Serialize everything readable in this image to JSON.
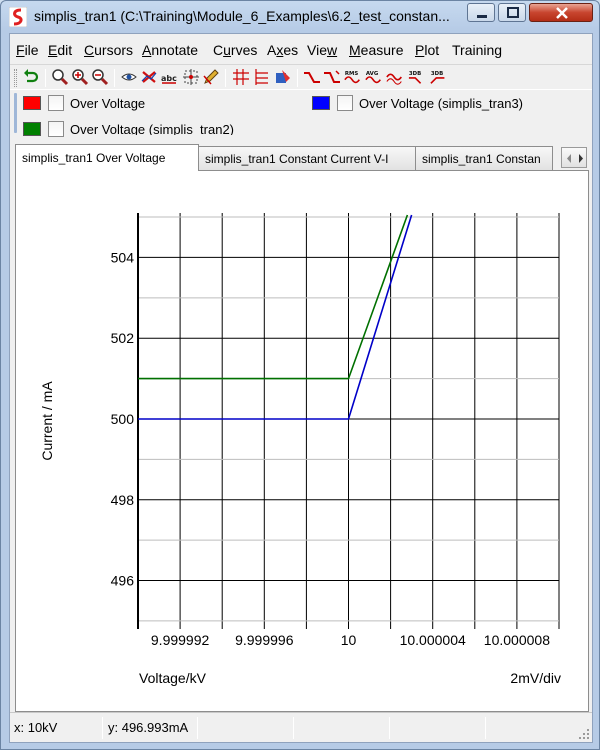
{
  "window": {
    "title": "simplis_tran1 (C:\\Training\\Module_6_Examples\\6.2_test_constan..."
  },
  "menu": [
    {
      "label": "File",
      "accel": "F",
      "rest": "ile"
    },
    {
      "label": "Edit",
      "accel": "E",
      "rest": "dit"
    },
    {
      "label": "Cursors",
      "accel": "C",
      "rest": "ursors"
    },
    {
      "label": "Annotate",
      "accel": "A",
      "rest": "nnotate"
    },
    {
      "label": "Curves",
      "accel": "u",
      "pre": "C",
      "rest": "rves"
    },
    {
      "label": "Axes",
      "accel": "x",
      "pre": "A",
      "rest": "es"
    },
    {
      "label": "View",
      "accel": "w",
      "pre": "Vie",
      "rest": ""
    },
    {
      "label": "Measure",
      "accel": "M",
      "rest": "easure"
    },
    {
      "label": "Plot",
      "accel": "P",
      "rest": "lot"
    },
    {
      "label": "Training",
      "accel": "",
      "rest": "Training"
    }
  ],
  "toolbar": {
    "icons": [
      "undo-icon",
      "zoom-icon",
      "zoom-in-icon",
      "zoom-out-icon",
      "eye-icon",
      "delete-curve-icon",
      "abc-label-icon",
      "cursor-icon",
      "pen-icon",
      "grid-icon",
      "stack-icon",
      "color-icon",
      "rise-icon",
      "fall-icon",
      "rms-icon",
      "avg-icon",
      "wave-icon",
      "3db-high-icon",
      "3db-low-icon"
    ],
    "rms_label": "RMS",
    "avg_label": "AVG",
    "db_label": "3DB"
  },
  "legend": [
    {
      "label": "Over Voltage",
      "color": "#ff0000"
    },
    {
      "label": "Over Voltage (simplis_tran3)",
      "color": "#0000ff"
    },
    {
      "label": "Over Voltage (simplis_tran2)",
      "color": "#008000"
    }
  ],
  "tabs": [
    {
      "label": "simplis_tran1 Over Voltage",
      "active": true
    },
    {
      "label": "simplis_tran1 Constant Current V-I",
      "active": false
    },
    {
      "label": "simplis_tran1 Constan",
      "active": false
    }
  ],
  "status": {
    "x": "x: 10kV",
    "y": "y: 496.993mA"
  },
  "chart_data": {
    "type": "line",
    "xlabel": "Voltage/kV",
    "ylabel": "Current / mA",
    "x_scale_label": "2mV/div",
    "xlim": [
      9.99999,
      10.00001
    ],
    "ylim": [
      494.8,
      505.1
    ],
    "x_tick_labels": [
      "9.999992",
      "9.999996",
      "10",
      "10.000004",
      "10.000008"
    ],
    "x_ticks": [
      9.999992,
      9.999996,
      10,
      10.000004,
      10.000008
    ],
    "y_tick_labels": [
      "496",
      "498",
      "500",
      "502",
      "504"
    ],
    "y_ticks": [
      496,
      498,
      500,
      502,
      504
    ],
    "grid": true,
    "series": [
      {
        "name": "Over Voltage (simplis_tran2)",
        "color": "#007000",
        "x": [
          9.99999,
          10,
          10.0000028
        ],
        "y": [
          501,
          501,
          505.05
        ]
      },
      {
        "name": "Over Voltage (simplis_tran3)",
        "color": "#0000c8",
        "x": [
          9.99999,
          10,
          10.000003
        ],
        "y": [
          500,
          500,
          505.05
        ]
      }
    ]
  }
}
